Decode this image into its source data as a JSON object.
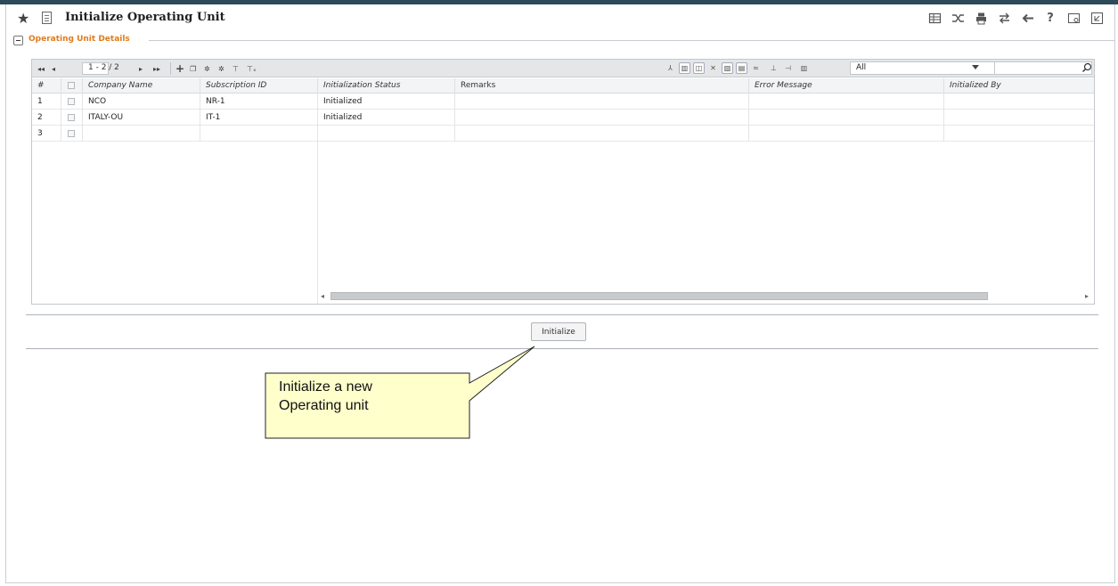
{
  "window": {
    "title": "Initialize Operating Unit"
  },
  "title_tools": [
    "grid-view-icon",
    "shuffle-icon",
    "print-icon",
    "transfer-icon",
    "back-arrow-icon",
    "help-icon",
    "settings-window-icon",
    "minimize-icon"
  ],
  "section": {
    "title": "Operating Unit Details",
    "collapsed": false
  },
  "grid": {
    "pagination": {
      "text": "1 - 2 / 2"
    },
    "filter": {
      "selected": "All"
    },
    "search": {
      "value": "",
      "placeholder": ""
    },
    "columns": [
      "#",
      "Company Name",
      "Subscription ID",
      "Initialization Status",
      "Remarks",
      "Error Message",
      "Initialized By"
    ],
    "rows": [
      {
        "num": "1",
        "company": "NCO",
        "subscription": "NR-1",
        "status": "Initialized",
        "remarks": "",
        "error": "",
        "initialized_by": ""
      },
      {
        "num": "2",
        "company": "ITALY-OU",
        "subscription": "IT-1",
        "status": "Initialized",
        "remarks": "",
        "error": "",
        "initialized_by": ""
      },
      {
        "num": "3",
        "company": "",
        "subscription": "",
        "status": "",
        "remarks": "",
        "error": "",
        "initialized_by": ""
      }
    ]
  },
  "actions": {
    "initialize_label": "Initialize"
  },
  "callout": {
    "line1": "Initialize a new",
    "line2": "Operating unit",
    "fill": "#ffffcc"
  },
  "colors": {
    "accent": "#e07b1a",
    "topbar": "#2c4a5a"
  }
}
